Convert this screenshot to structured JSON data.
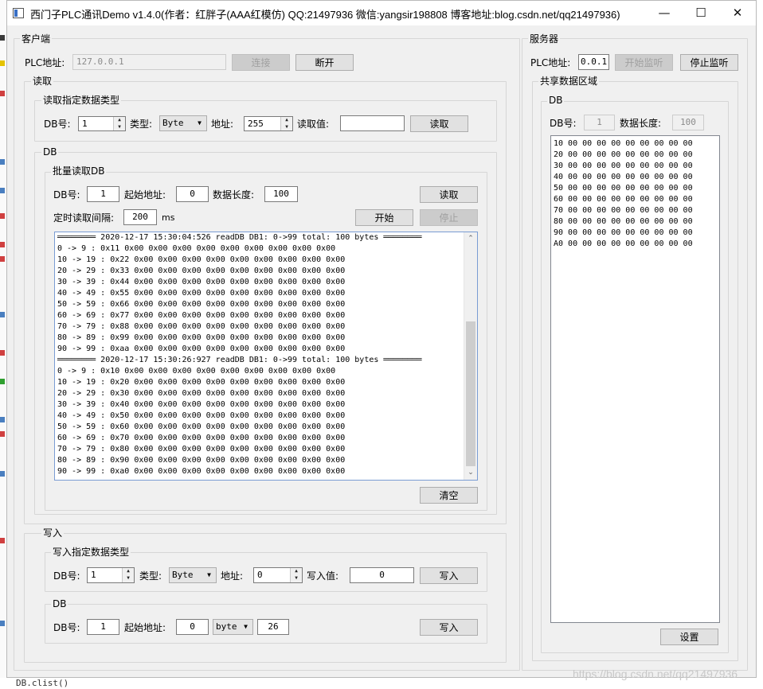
{
  "window": {
    "title": "西门子PLC通讯Demo v1.4.0(作者：红胖子(AAA红模仿) QQ:21497936 微信:yangsir198808 博客地址:blog.csdn.net/qq21497936)",
    "minimize": "—",
    "maximize": "☐",
    "close": "✕"
  },
  "client": {
    "group_title": "客户端",
    "plc_address_label": "PLC地址:",
    "plc_address_value": "127.0.0.1",
    "connect_button": "连接",
    "disconnect_button": "断开",
    "read": {
      "group_title": "读取",
      "typed": {
        "group_title": "读取指定数据类型",
        "db_label": "DB号:",
        "db_value": "1",
        "type_label": "类型:",
        "type_value": "Byte",
        "address_label": "地址:",
        "address_value": "255",
        "read_value_label": "读取值:",
        "read_value": "",
        "read_button": "读取"
      },
      "db": {
        "group_title": "DB",
        "batch": {
          "group_title": "批量读取DB",
          "db_label": "DB号:",
          "db_value": "1",
          "start_label": "起始地址:",
          "start_value": "0",
          "length_label": "数据长度:",
          "length_value": "100",
          "read_button": "读取",
          "interval_label": "定时读取间隔:",
          "interval_value": "200",
          "interval_unit": "ms",
          "start_button": "开始",
          "stop_button": "停止"
        },
        "log_lines": [
          "════════ 2020-12-17 15:30:04:526 readDB DB1: 0->99 total: 100 bytes ════════",
          "0 -> 9 : 0x11 0x00 0x00 0x00 0x00 0x00 0x00 0x00 0x00 0x00",
          "10 -> 19 : 0x22 0x00 0x00 0x00 0x00 0x00 0x00 0x00 0x00 0x00",
          "20 -> 29 : 0x33 0x00 0x00 0x00 0x00 0x00 0x00 0x00 0x00 0x00",
          "30 -> 39 : 0x44 0x00 0x00 0x00 0x00 0x00 0x00 0x00 0x00 0x00",
          "40 -> 49 : 0x55 0x00 0x00 0x00 0x00 0x00 0x00 0x00 0x00 0x00",
          "50 -> 59 : 0x66 0x00 0x00 0x00 0x00 0x00 0x00 0x00 0x00 0x00",
          "60 -> 69 : 0x77 0x00 0x00 0x00 0x00 0x00 0x00 0x00 0x00 0x00",
          "70 -> 79 : 0x88 0x00 0x00 0x00 0x00 0x00 0x00 0x00 0x00 0x00",
          "80 -> 89 : 0x99 0x00 0x00 0x00 0x00 0x00 0x00 0x00 0x00 0x00",
          "90 -> 99 : 0xaa 0x00 0x00 0x00 0x00 0x00 0x00 0x00 0x00 0x00",
          "════════ 2020-12-17 15:30:26:927 readDB DB1: 0->99 total: 100 bytes ════════",
          "0 -> 9 : 0x10 0x00 0x00 0x00 0x00 0x00 0x00 0x00 0x00 0x00",
          "10 -> 19 : 0x20 0x00 0x00 0x00 0x00 0x00 0x00 0x00 0x00 0x00",
          "20 -> 29 : 0x30 0x00 0x00 0x00 0x00 0x00 0x00 0x00 0x00 0x00",
          "30 -> 39 : 0x40 0x00 0x00 0x00 0x00 0x00 0x00 0x00 0x00 0x00",
          "40 -> 49 : 0x50 0x00 0x00 0x00 0x00 0x00 0x00 0x00 0x00 0x00",
          "50 -> 59 : 0x60 0x00 0x00 0x00 0x00 0x00 0x00 0x00 0x00 0x00",
          "60 -> 69 : 0x70 0x00 0x00 0x00 0x00 0x00 0x00 0x00 0x00 0x00",
          "70 -> 79 : 0x80 0x00 0x00 0x00 0x00 0x00 0x00 0x00 0x00 0x00",
          "80 -> 89 : 0x90 0x00 0x00 0x00 0x00 0x00 0x00 0x00 0x00 0x00",
          "90 -> 99 : 0xa0 0x00 0x00 0x00 0x00 0x00 0x00 0x00 0x00 0x00"
        ],
        "clear_button": "清空"
      }
    },
    "write": {
      "group_title": "写入",
      "typed": {
        "group_title": "写入指定数据类型",
        "db_label": "DB号:",
        "db_value": "1",
        "type_label": "类型:",
        "type_value": "Byte",
        "address_label": "地址:",
        "address_value": "0",
        "write_value_label": "写入值:",
        "write_value": "0",
        "write_button": "写入"
      },
      "db": {
        "group_title": "DB",
        "db_label": "DB号:",
        "db_value": "1",
        "start_label": "起始地址:",
        "start_value": "0",
        "unit_value": "byte",
        "length_value": "26",
        "write_button": "写入"
      }
    }
  },
  "server": {
    "group_title": "服务器",
    "plc_address_label": "PLC地址:",
    "plc_address_value": "0.0.1",
    "start_listen_button": "开始监听",
    "stop_listen_button": "停止监听",
    "shared": {
      "group_title": "共享数据区域",
      "db": {
        "group_title": "DB",
        "db_label": "DB号:",
        "db_value": "1",
        "length_label": "数据长度:",
        "length_value": "100",
        "data_lines": [
          "10 00 00 00 00 00 00 00 00 00",
          "20 00 00 00 00 00 00 00 00 00",
          "30 00 00 00 00 00 00 00 00 00",
          "40 00 00 00 00 00 00 00 00 00",
          "50 00 00 00 00 00 00 00 00 00",
          "60 00 00 00 00 00 00 00 00 00",
          "70 00 00 00 00 00 00 00 00 00",
          "80 00 00 00 00 00 00 00 00 00",
          "90 00 00 00 00 00 00 00 00 00",
          "A0 00 00 00 00 00 00 00 00 00"
        ],
        "set_button": "设置"
      }
    }
  },
  "watermark": "https://blog.csdn.net/qq21497936",
  "editor_bottom_text": "   DB.clist()"
}
